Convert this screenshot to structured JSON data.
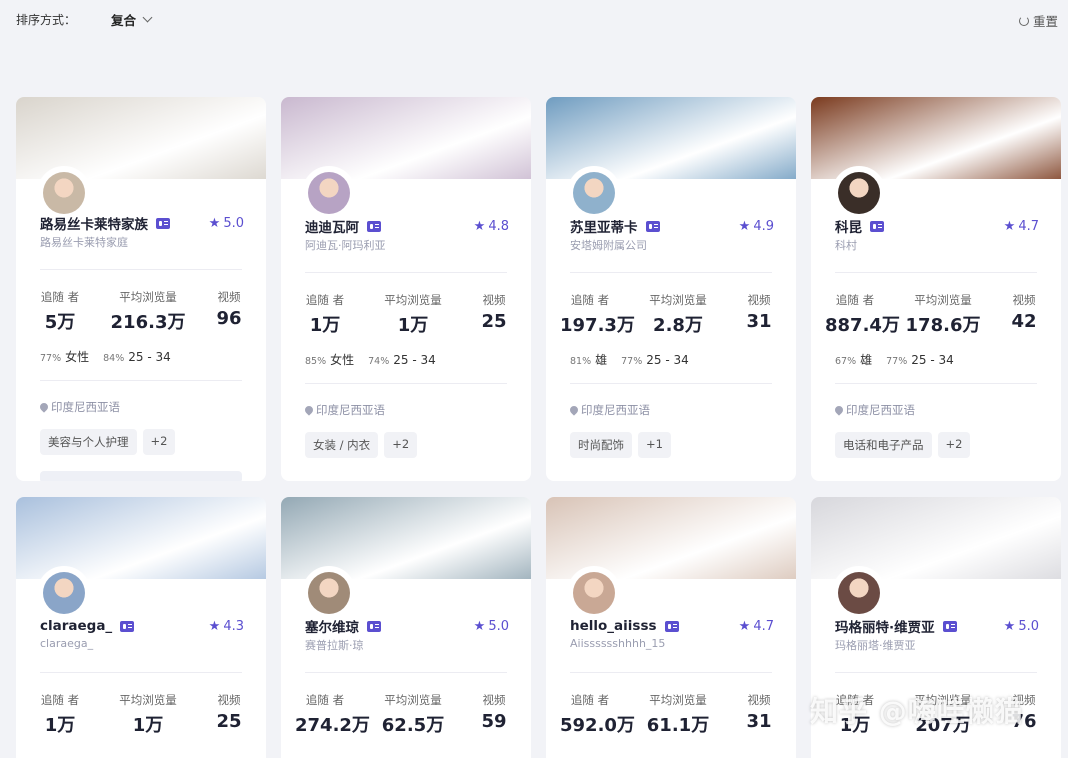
{
  "toolbar": {
    "sort_label": "排序方式：",
    "sort_value": "复合",
    "reset_label": "重置"
  },
  "labels": {
    "followers": "追随 者",
    "avg_views": "平均浏览量",
    "videos": "视频"
  },
  "cards": [
    {
      "name": "路易丝卡莱特家族",
      "subname": "路易丝卡莱特家庭",
      "rating": "5.0",
      "followers": "5万",
      "avg_views": "216.3万",
      "videos": "96",
      "gender_pct": "77%",
      "gender": "女性",
      "age_pct": "84%",
      "age": "25 - 34",
      "location": "印度尼西亚语",
      "tags": [
        "美容与个人护理",
        "+2"
      ],
      "banner_color": "#d9d4cc",
      "avatar_color": "#c9b9a6"
    },
    {
      "name": "迪迪瓦阿",
      "subname": "阿迪瓦·阿玛利亚",
      "rating": "4.8",
      "followers": "1万",
      "avg_views": "1万",
      "videos": "25",
      "gender_pct": "85%",
      "gender": "女性",
      "age_pct": "74%",
      "age": "25 - 34",
      "location": "印度尼西亚语",
      "tags": [
        "女装 / 内衣",
        "+2"
      ],
      "banner_color": "#c9b8cf",
      "avatar_color": "#b7a3c4"
    },
    {
      "name": "苏里亚蒂卡",
      "subname": "安塔姆附属公司",
      "rating": "4.9",
      "followers": "197.3万",
      "avg_views": "2.8万",
      "videos": "31",
      "gender_pct": "81%",
      "gender": "雄",
      "age_pct": "77%",
      "age": "25 - 34",
      "location": "印度尼西亚语",
      "tags": [
        "时尚配饰",
        "+1"
      ],
      "banner_color": "#6f9cc0",
      "avatar_color": "#8fb1cc"
    },
    {
      "name": "科昆",
      "subname": "科村",
      "rating": "4.7",
      "followers": "887.4万",
      "avg_views": "178.6万",
      "videos": "42",
      "gender_pct": "67%",
      "gender": "雄",
      "age_pct": "77%",
      "age": "25 - 34",
      "location": "印度尼西亚语",
      "tags": [
        "电话和电子产品",
        "+2"
      ],
      "banner_color": "#7a3a1e",
      "avatar_color": "#3a2e28"
    },
    {
      "name": "claraega_",
      "subname": "claraega_",
      "rating": "4.3",
      "followers": "1万",
      "avg_views": "1万",
      "videos": "25",
      "banner_color": "#a9c0dd",
      "avatar_color": "#8aa5c8"
    },
    {
      "name": "塞尔维琼",
      "subname": "赛普拉斯·琼",
      "rating": "5.0",
      "followers": "274.2万",
      "avg_views": "62.5万",
      "videos": "59",
      "banner_color": "#93a8b4",
      "avatar_color": "#a08b78"
    },
    {
      "name": "hello_aiisss",
      "subname": "Aiisssssshhhh_15",
      "rating": "4.7",
      "followers": "592.0万",
      "avg_views": "61.1万",
      "videos": "31",
      "banner_color": "#d8c3b6",
      "avatar_color": "#c9a895"
    },
    {
      "name": "玛格丽特·维贾亚",
      "subname": "玛格丽塔·维贾亚",
      "rating": "5.0",
      "followers": "1万",
      "avg_views": "207万",
      "videos": "76",
      "banner_color": "#d7d7dc",
      "avatar_color": "#6b4b44"
    }
  ],
  "watermark": "知乎 @嗨哇懒猫"
}
